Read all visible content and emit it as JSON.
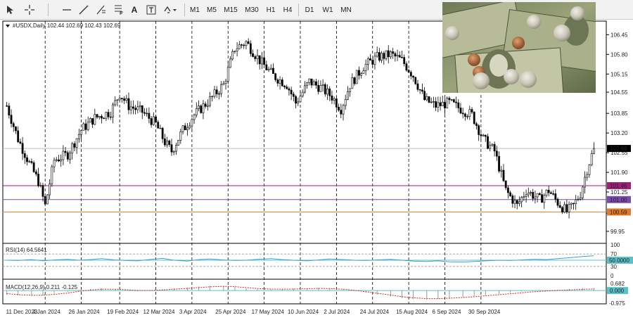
{
  "toolbar": {
    "timeframes": [
      "M1",
      "M5",
      "M15",
      "M30",
      "H1",
      "H4",
      "D1",
      "W1",
      "MN"
    ],
    "text_tool": "A"
  },
  "chart": {
    "symbol_info": "#USDX,Daily",
    "ohlc": "102.44 102.69 102.43 102.69",
    "price_labels": [
      "106.45",
      "105.80",
      "105.15",
      "104.55",
      "103.85",
      "103.20",
      "102.55",
      "101.90",
      "101.25",
      "100.55",
      "99.95"
    ],
    "current_price": "102.69",
    "hlines": [
      {
        "price": "101.46",
        "color": "#9c1f78"
      },
      {
        "price": "101.00",
        "color": "#7b4aa8"
      },
      {
        "price": "100.59",
        "color": "#e07a2a"
      }
    ],
    "date_labels": [
      "11 Dec 2023",
      "4 Jan 2024",
      "26 Jan 2024",
      "19 Feb 2024",
      "12 Mar 2024",
      "3 Apr 2024",
      "25 Apr 2024",
      "17 May 2024",
      "10 Jun 2024",
      "2 Jul 2024",
      "24 Jul 2024",
      "15 Aug 2024",
      "6 Sep 2024",
      "30 Sep 2024"
    ]
  },
  "rsi": {
    "label": "RSI(14) 64.5641",
    "levels": [
      "100",
      "70",
      "50.0000",
      "30",
      "0"
    ]
  },
  "macd": {
    "label": "MACD(12,26,9) 0.211 -0.125",
    "levels": [
      "0.682",
      "0.000",
      "-0.975"
    ]
  },
  "chart_data": {
    "type": "candlestick",
    "anchors": [
      [
        0,
        104.1
      ],
      [
        5,
        103.0
      ],
      [
        10,
        102.2
      ],
      [
        14,
        101.6
      ],
      [
        17,
        100.8
      ],
      [
        21,
        102.3
      ],
      [
        27,
        102.5
      ],
      [
        33,
        103.3
      ],
      [
        39,
        103.7
      ],
      [
        46,
        103.9
      ],
      [
        50,
        104.5
      ],
      [
        54,
        104.1
      ],
      [
        60,
        103.9
      ],
      [
        66,
        103.5
      ],
      [
        70,
        102.9
      ],
      [
        73,
        102.6
      ],
      [
        78,
        103.3
      ],
      [
        83,
        103.8
      ],
      [
        90,
        104.3
      ],
      [
        96,
        104.8
      ],
      [
        101,
        106.0
      ],
      [
        106,
        106.2
      ],
      [
        112,
        105.6
      ],
      [
        118,
        105.1
      ],
      [
        124,
        104.8
      ],
      [
        128,
        104.2
      ],
      [
        134,
        104.9
      ],
      [
        139,
        104.7
      ],
      [
        144,
        104.4
      ],
      [
        148,
        104.0
      ],
      [
        152,
        104.8
      ],
      [
        158,
        105.4
      ],
      [
        164,
        105.7
      ],
      [
        170,
        105.8
      ],
      [
        175,
        105.6
      ],
      [
        180,
        105.1
      ],
      [
        185,
        104.3
      ],
      [
        190,
        104.1
      ],
      [
        196,
        104.2
      ],
      [
        201,
        104.0
      ],
      [
        206,
        103.8
      ],
      [
        211,
        103.0
      ],
      [
        216,
        102.6
      ],
      [
        221,
        101.3
      ],
      [
        226,
        100.8
      ],
      [
        230,
        101.3
      ],
      [
        236,
        101.0
      ],
      [
        240,
        101.3
      ],
      [
        244,
        100.9
      ],
      [
        248,
        100.6
      ],
      [
        251,
        100.8
      ],
      [
        254,
        101.2
      ],
      [
        257,
        102.0
      ],
      [
        260,
        102.7
      ]
    ],
    "rsi_series": [
      50,
      49,
      52,
      48,
      51,
      53,
      50,
      52,
      55,
      51,
      49,
      48,
      53,
      56,
      50,
      47,
      52,
      54,
      51,
      49,
      50,
      53,
      55,
      52,
      50,
      48,
      51,
      54,
      52,
      50,
      49,
      51,
      53,
      50,
      47,
      46,
      48,
      45,
      44,
      46,
      48,
      50,
      49,
      51,
      53,
      52,
      55,
      58,
      62,
      64.5641
    ],
    "macd_hist": [
      -0.3,
      -0.36,
      -0.4,
      -0.34,
      -0.22,
      -0.08,
      0.05,
      0.12,
      0.16,
      0.1,
      0.03,
      -0.05,
      0.02,
      0.1,
      0.16,
      0.22,
      0.3,
      0.36,
      0.34,
      0.26,
      0.16,
      0.1,
      0.08,
      0.1,
      0.14,
      0.18,
      0.2,
      0.16,
      0.08,
      -0.04,
      -0.16,
      -0.3,
      -0.44,
      -0.55,
      -0.62,
      -0.66,
      -0.6,
      -0.55,
      -0.48,
      -0.4,
      -0.32,
      -0.24,
      -0.16,
      -0.08,
      -0.02,
      0.03,
      0.08,
      0.13,
      0.18,
      0.21
    ],
    "macd_signal": [
      -0.22,
      -0.3,
      -0.35,
      -0.34,
      -0.28,
      -0.18,
      -0.06,
      0.04,
      0.1,
      0.1,
      0.06,
      0.01,
      0.01,
      0.05,
      0.1,
      0.16,
      0.22,
      0.28,
      0.31,
      0.29,
      0.22,
      0.15,
      0.11,
      0.1,
      0.11,
      0.14,
      0.16,
      0.15,
      0.1,
      0.02,
      -0.08,
      -0.2,
      -0.33,
      -0.45,
      -0.53,
      -0.59,
      -0.59,
      -0.56,
      -0.51,
      -0.45,
      -0.38,
      -0.3,
      -0.23,
      -0.16,
      -0.09,
      -0.03,
      0.01,
      0.05,
      0.09,
      0.12
    ]
  }
}
